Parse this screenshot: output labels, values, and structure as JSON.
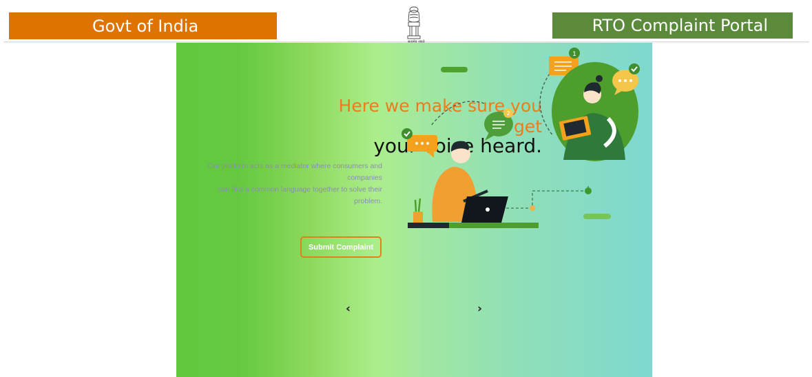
{
  "header": {
    "left_banner": "Govt of India",
    "right_banner": "RTO Complaint Portal",
    "emblem_caption": "सत्यमेव जयते",
    "colors": {
      "left": "#df7300",
      "right": "#5a8a3a"
    }
  },
  "hero": {
    "headline_line1": "Here we make sure you",
    "headline_line2": "get",
    "headline_line3": "your voice heard.",
    "description": "Our platform acts as a mediator where consumers and companies can find a common language together to solve their problem.",
    "description_lines": [
      "Our platform acts as a mediator where consumers and",
      "companies",
      "can find a common language together to solve their",
      "problem."
    ],
    "submit_label": "Submit Complaint",
    "prev_label": "‹",
    "next_label": "›",
    "badge_one": "1",
    "badge_two": "2",
    "colors": {
      "accent": "#ee7b1c",
      "gradient_start": "#62c93f",
      "gradient_end": "#7ed8cf"
    }
  }
}
